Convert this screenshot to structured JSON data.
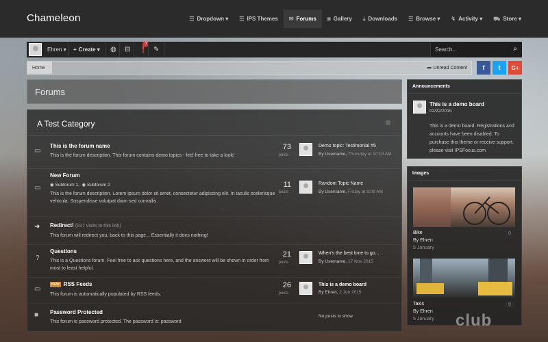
{
  "brand": {
    "name": "Chameleon"
  },
  "nav": [
    {
      "label": "Dropdown ▾",
      "icon": "menu-icon"
    },
    {
      "label": "IPS Themes",
      "icon": "menu-icon"
    },
    {
      "label": "Forums",
      "icon": "chat-icon",
      "active": true
    },
    {
      "label": "Gallery",
      "icon": "camera-icon"
    },
    {
      "label": "Downloads",
      "icon": "download-icon"
    },
    {
      "label": "Browse ▾",
      "icon": "menu-icon"
    },
    {
      "label": "Activity ▾",
      "icon": "activity-icon"
    },
    {
      "label": "Store ▾",
      "icon": "cart-icon"
    }
  ],
  "userbar": {
    "username": "Ehren ▾",
    "create": "Create ▾",
    "notif_count": "3",
    "search_placeholder": "Search..."
  },
  "breadcrumb": {
    "home": "Home",
    "unread": "Unread Content"
  },
  "social": {
    "facebook": "f",
    "twitter": "t",
    "google": "G+"
  },
  "page": {
    "title": "Forums"
  },
  "category": {
    "title": "A Test Category"
  },
  "forums": [
    {
      "name": "This is the forum name",
      "desc": "This is the forum description. This forum contains demo topics - feel free to take a look!",
      "count": "73",
      "count_label": "posts",
      "last_title": "Demo topic: Testimonial #5",
      "last_by": "By Username,",
      "last_when": "Thursday at 10:19 AM"
    },
    {
      "name": "New Forum",
      "subforum1": "Subforum 1,",
      "subforum2": "Subforum 2",
      "desc": "This is the forum description. Lorem ipsum dolor sit amet, consectetur adipiscing elit. In iaculis scelerisque vehicula. Suspendisse volutpat diam sed convallis.",
      "count": "11",
      "count_label": "posts",
      "last_title": "Random Topic Name",
      "last_by": "By Username,",
      "last_when": "Friday at 8:08 AM"
    },
    {
      "name": "Redirect!",
      "note": "(917 visits to this link)",
      "desc": "This forum will redirect you, back to this page... Essentially it does nothing!"
    },
    {
      "name": "Questions",
      "desc": "This is a Questions forum. Feel free to ask questions here, and the answers will be shown in order from most to least helpful.",
      "count": "21",
      "count_label": "posts",
      "last_title": "When's the best time to go...",
      "last_by": "By Username,",
      "last_when": "17 Nov 2015"
    },
    {
      "badge": "NEW",
      "name": "RSS Feeds",
      "desc": "This forum is automatically populated by RSS feeds.",
      "count": "26",
      "count_label": "posts",
      "last_title": "This is a demo board",
      "last_by": "By Ehren,",
      "last_when": "2 Jun 2015"
    },
    {
      "name": "Password Protected",
      "desc": "This forum is password protected. The password is: password",
      "last_title": "No posts to show"
    }
  ],
  "announcements": {
    "title": "Announcements",
    "item_title": "This is a demo board",
    "item_date": "02/22/2015",
    "item_body": "This is a demo board. Registrations and accounts have been disabled. To purchase this theme or receive support, please visit IPSFocus.com"
  },
  "images": {
    "title": "Images",
    "items": [
      {
        "title": "Bike",
        "by": "By Ehren",
        "date": "5 January",
        "count": "0"
      },
      {
        "title": "Taxis",
        "by": "By Ehren",
        "date": "5 January",
        "count": "0"
      }
    ]
  },
  "watermark": "club"
}
